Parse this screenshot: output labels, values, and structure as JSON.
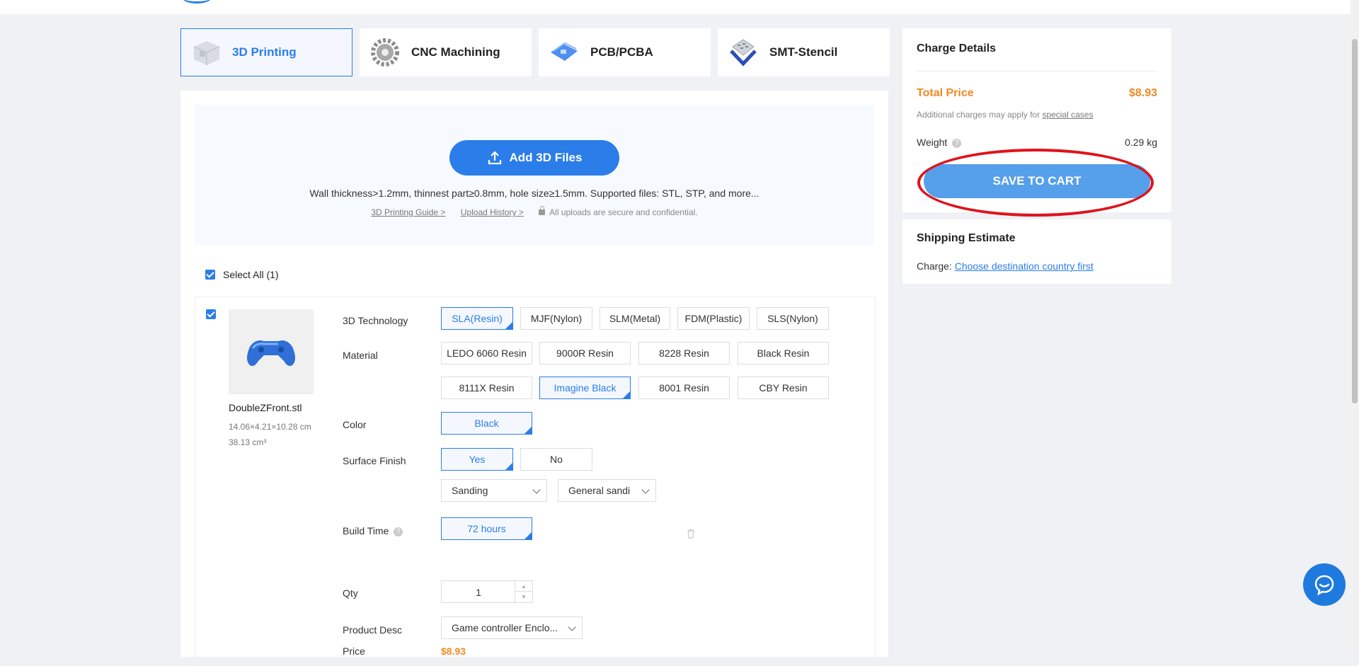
{
  "tabs": [
    {
      "label": "3D Printing",
      "active": true
    },
    {
      "label": "CNC Machining",
      "active": false
    },
    {
      "label": "PCB/PCBA",
      "active": false
    },
    {
      "label": "SMT-Stencil",
      "active": false
    }
  ],
  "upload": {
    "button_label": "Add 3D Files",
    "hint": "Wall thickness>1.2mm, thinnest part≥0.8mm, hole size≥1.5mm. Supported files: STL, STP, and more...",
    "guide_link": "3D Printing Guide >",
    "history_link": "Upload History >",
    "secure_note": "All uploads are secure and confidential."
  },
  "select_all_label": "Select All (1)",
  "item": {
    "file_name": "DoubleZFront.stl",
    "dimensions": "14.06×4.21×10.28 cm",
    "volume": "38.13 cm³",
    "technology_label": "3D Technology",
    "technologies": [
      "SLA(Resin)",
      "MJF(Nylon)",
      "SLM(Metal)",
      "FDM(Plastic)",
      "SLS(Nylon)"
    ],
    "material_label": "Material",
    "materials": [
      "LEDO 6060 Resin",
      "9000R Resin",
      "8228 Resin",
      "Black Resin",
      "8111X Resin",
      "Imagine Black",
      "8001 Resin",
      "CBY Resin"
    ],
    "color_label": "Color",
    "color_value": "Black",
    "surface_label": "Surface Finish",
    "surface_yes": "Yes",
    "surface_no": "No",
    "finish_type": "Sanding",
    "finish_detail": "General sandi",
    "build_label": "Build Time",
    "build_value": "72 hours",
    "qty_label": "Qty",
    "qty_value": "1",
    "desc_label": "Product Desc",
    "desc_value": "Game controller Enclo...",
    "price_label": "Price",
    "price_value": "$8.93"
  },
  "charge": {
    "title": "Charge Details",
    "total_label": "Total Price",
    "total_value": "$8.93",
    "additional_prefix": "Additional charges may apply for",
    "special_cases_link": "special cases",
    "weight_label": "Weight",
    "weight_value": "0.29 kg",
    "save_button": "SAVE TO CART"
  },
  "shipping": {
    "title": "Shipping Estimate",
    "charge_label": "Charge:",
    "charge_link": "Choose destination country first"
  },
  "colors": {
    "accent": "#2b7de9",
    "price": "#f08a24",
    "annotation": "#e0121b"
  }
}
